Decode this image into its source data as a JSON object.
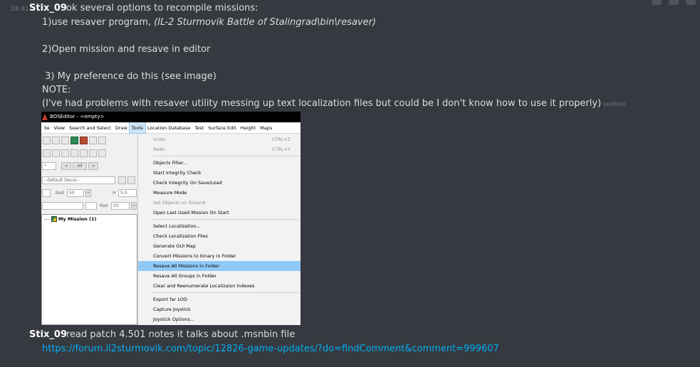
{
  "message1": {
    "timestamp": "18:41",
    "username": "Stix_09",
    "first_line": "ok several options to recompile missions:",
    "option1_prefix": "1)use resaver program, ",
    "option1_path": "(IL-2 Sturmovik Battle of Stalingrad\\bin\\resaver)",
    "option2": "2)Open mission and resave in editor",
    "option3": " 3) My preference do this (see image)",
    "note_label": "NOTE:",
    "note_text": "(I've had problems with resaver utility messing up text localization files but could be I don't know how to use it properly)",
    "edited": "(edited)"
  },
  "screenshot": {
    "title": "BOSEditor - <empty>",
    "menubar": [
      "ile",
      "View",
      "Search and Select",
      "Draw",
      "Tools",
      "Location Database",
      "Test",
      "Surface Edit",
      "Height",
      "Maps"
    ],
    "active_menu": "Tools",
    "left_panel": {
      "all_button": "All",
      "decal_select": "--Default Decal--",
      "rad_label": "Rad",
      "rad_value": "50",
      "h_label": "H",
      "h_value": "5.0",
      "rad2_label": "Rad",
      "rad2_value": "50",
      "tree_item": "My Mission (1)"
    },
    "tools_menu": [
      {
        "label": "Undo",
        "shortcut": "CTRL+Z",
        "disabled": true
      },
      {
        "label": "Redo",
        "shortcut": "CTRL+Y",
        "disabled": true
      },
      {
        "label": "Objects Filter..."
      },
      {
        "label": "Start Integrity Check"
      },
      {
        "label": "Check Integrity On Save/Load"
      },
      {
        "label": "Measure Mode"
      },
      {
        "label": "Set Objects on Ground",
        "disabled": true
      },
      {
        "label": "Open Last Used Mission On Start"
      },
      {
        "label": "Select Localization..."
      },
      {
        "label": "Check Localization Files"
      },
      {
        "label": "Generate GUI Map"
      },
      {
        "label": "Convert Missions to binary in Folder"
      },
      {
        "label": "Resave All Missions in Folder",
        "highlighted": true
      },
      {
        "label": "Resave All Groups in Folder"
      },
      {
        "label": "Clear and Reenumerate Localizaion Indexes"
      },
      {
        "label": "Export far LOD"
      },
      {
        "label": "Capture Joystick"
      },
      {
        "label": "Joystick Options..."
      }
    ]
  },
  "message2": {
    "username": "Stix_09",
    "text": "read patch 4.501 notes it talks about .msnbin file",
    "link": "https://forum.il2sturmovik.com/topic/12826-game-updates/?do=findComment&comment=999607"
  },
  "colors": {
    "background": "#36393f",
    "link": "#00b0f4",
    "menu_highlight": "#91c9f7"
  }
}
